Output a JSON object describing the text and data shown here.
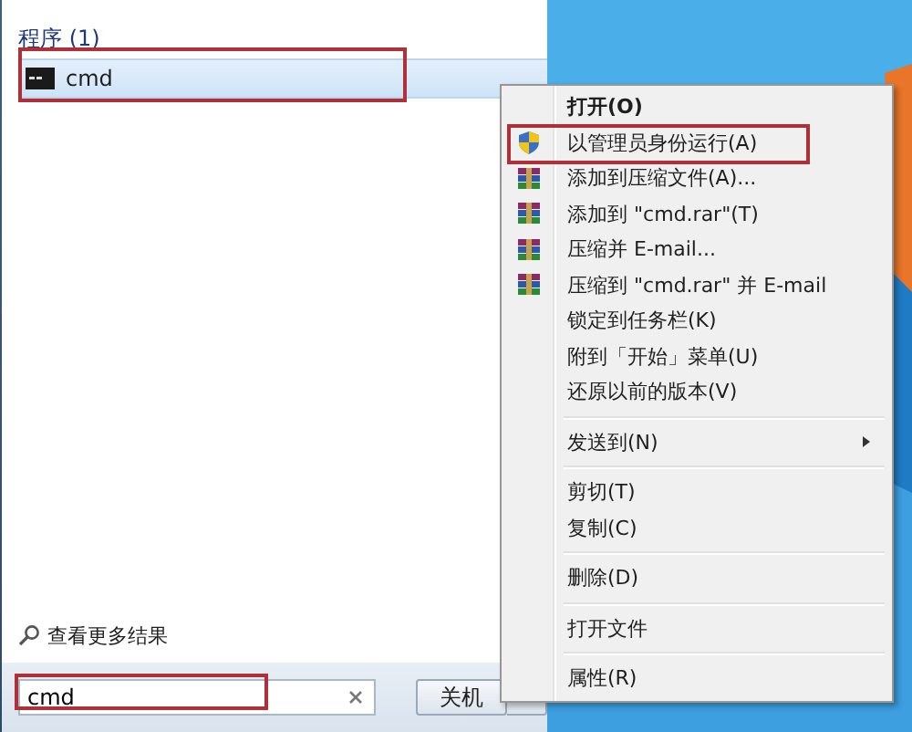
{
  "programs": {
    "header": "程序 (1)",
    "items": [
      {
        "label": "cmd",
        "selected": true,
        "highlighted": true
      }
    ]
  },
  "more_results": "查看更多结果",
  "search": {
    "value": "cmd",
    "highlighted": true
  },
  "shutdown": {
    "label": "关机"
  },
  "context_menu": {
    "items": [
      {
        "kind": "plain",
        "label": "打开(O)",
        "bold": true,
        "highlighted": false
      },
      {
        "kind": "shield",
        "label": "以管理员身份运行(A)",
        "bold": false,
        "highlighted": true
      },
      {
        "kind": "archive",
        "label": "添加到压缩文件(A)...",
        "bold": false,
        "highlighted": false
      },
      {
        "kind": "archive",
        "label": "添加到 \"cmd.rar\"(T)",
        "bold": false,
        "highlighted": false
      },
      {
        "kind": "archive",
        "label": "压缩并 E-mail...",
        "bold": false,
        "highlighted": false
      },
      {
        "kind": "archive",
        "label": "压缩到 \"cmd.rar\" 并 E-mail",
        "bold": false,
        "highlighted": false
      },
      {
        "kind": "plain",
        "label": "锁定到任务栏(K)",
        "bold": false,
        "highlighted": false
      },
      {
        "kind": "plain",
        "label": "附到「开始」菜单(U)",
        "bold": false,
        "highlighted": false
      },
      {
        "kind": "plain",
        "label": "还原以前的版本(V)",
        "bold": false,
        "highlighted": false
      },
      {
        "kind": "separator"
      },
      {
        "kind": "submenu",
        "label": "发送到(N)",
        "bold": false,
        "highlighted": false
      },
      {
        "kind": "separator"
      },
      {
        "kind": "plain",
        "label": "剪切(T)",
        "bold": false,
        "highlighted": false
      },
      {
        "kind": "plain",
        "label": "复制(C)",
        "bold": false,
        "highlighted": false
      },
      {
        "kind": "separator"
      },
      {
        "kind": "plain",
        "label": "删除(D)",
        "bold": false,
        "highlighted": false
      },
      {
        "kind": "separator"
      },
      {
        "kind": "plain",
        "label": "打开文件",
        "bold": false,
        "highlighted": false
      },
      {
        "kind": "separator"
      },
      {
        "kind": "plain",
        "label": "属性(R)",
        "bold": false,
        "highlighted": false
      }
    ]
  }
}
